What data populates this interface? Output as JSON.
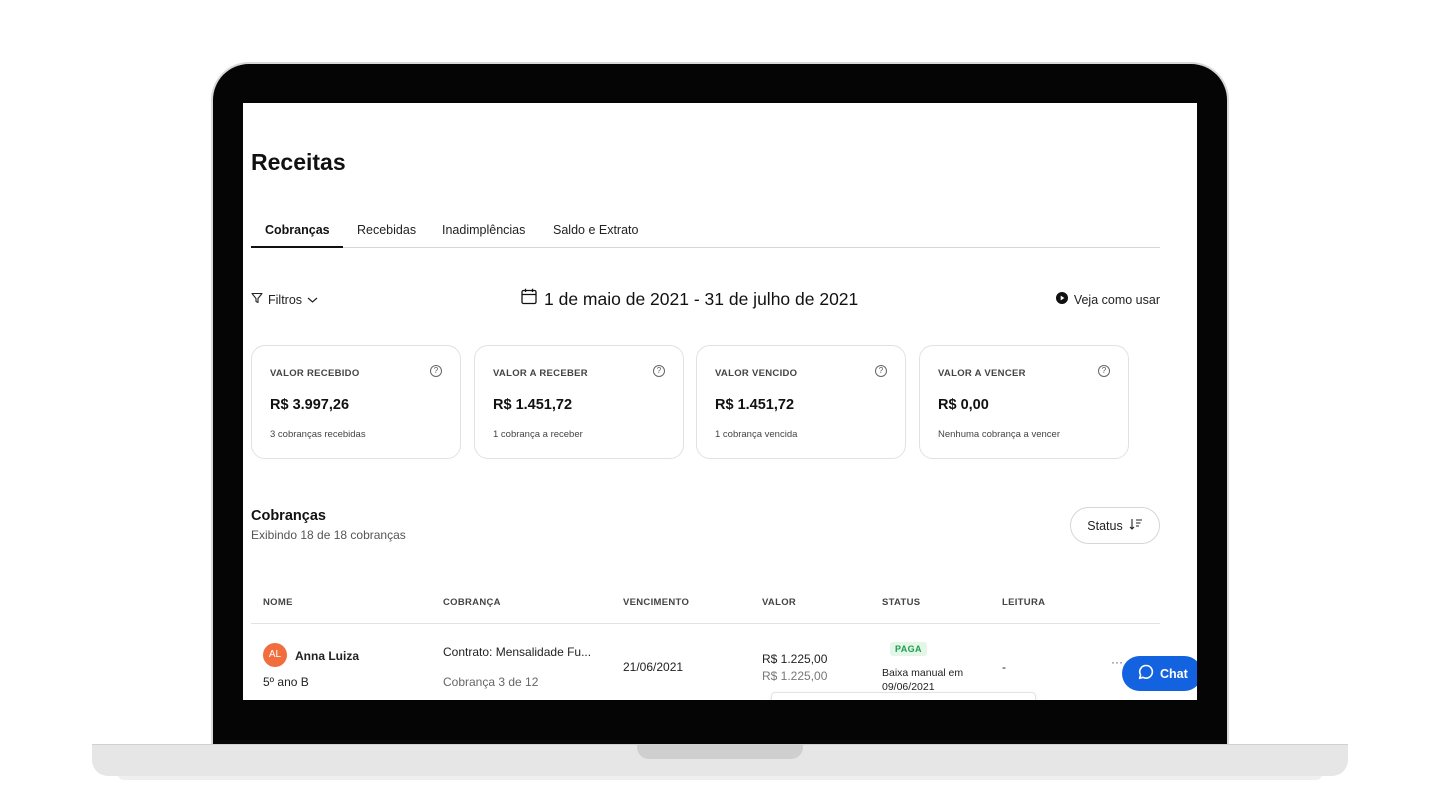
{
  "page": {
    "title": "Receitas"
  },
  "tabs": [
    {
      "label": "Cobranças",
      "active": true
    },
    {
      "label": "Recebidas",
      "active": false
    },
    {
      "label": "Inadimplências",
      "active": false
    },
    {
      "label": "Saldo e Extrato",
      "active": false
    }
  ],
  "toolbar": {
    "filters_label": "Filtros",
    "date_range": "1 de maio de 2021 - 31 de julho de 2021",
    "howto_label": "Veja como usar"
  },
  "cards": [
    {
      "label": "VALOR RECEBIDO",
      "value": "R$ 3.997,26",
      "sub": "3 cobranças recebidas"
    },
    {
      "label": "VALOR A RECEBER",
      "value": "R$ 1.451,72",
      "sub": "1 cobrança a receber"
    },
    {
      "label": "VALOR VENCIDO",
      "value": "R$ 1.451,72",
      "sub": "1 cobrança vencida"
    },
    {
      "label": "VALOR A VENCER",
      "value": "R$ 0,00",
      "sub": "Nenhuma cobrança a vencer"
    }
  ],
  "charges": {
    "title": "Cobranças",
    "subtitle": "Exibindo 18 de 18 cobranças",
    "status_button": "Status",
    "columns": [
      "NOME",
      "COBRANÇA",
      "VENCIMENTO",
      "VALOR",
      "STATUS",
      "LEITURA"
    ],
    "rows": [
      {
        "avatar_initials": "AL",
        "name": "Anna Luiza",
        "class": "5º ano B",
        "charge_title": "Contrato: Mensalidade Fu...",
        "charge_sub": "Cobrança 3 de 12",
        "due_date": "21/06/2021",
        "value": "R$ 1.225,00",
        "value_sub": "R$ 1.225,00",
        "status_badge": "PAGA",
        "status_note_1": "Baixa manual em",
        "status_note_2": "09/06/2021",
        "reading": "-",
        "more": "···"
      }
    ]
  },
  "chat": {
    "label": "Chat"
  },
  "colors": {
    "accent": "#1363e0",
    "avatar": "#f26d3d",
    "paid_bg": "#e3f6e8",
    "paid_text": "#1f9d4c"
  }
}
